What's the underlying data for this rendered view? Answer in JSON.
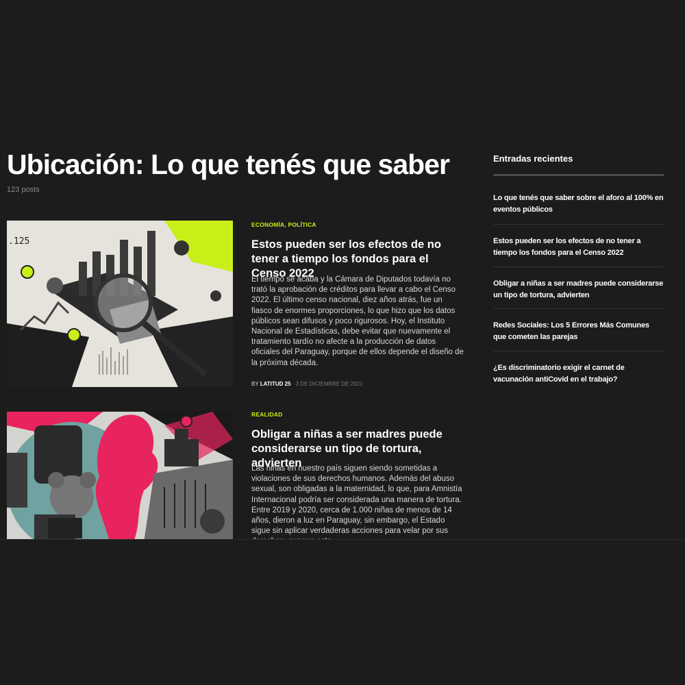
{
  "archive": {
    "title": "Ubicación: Lo que tenés que saber",
    "post_count": "123 posts"
  },
  "articles": [
    {
      "categories": [
        "ECONOMÍA",
        "POLÍTICA"
      ],
      "category_separator": ",",
      "title": "Estos pueden ser los efectos de no tener a tiempo los fondos para el Censo 2022",
      "excerpt": "El tiempo se acaba y la Cámara de Diputados todavía no trató la aprobación de créditos para llevar a cabo el Censo 2022. El último censo nacional, diez años atrás, fue un fiasco de enormes proporciones, lo que hizo que los datos públicos sean difusos y poco rigurosos. Hoy, el Instituto Nacional de Estadísticas, debe evitar que nuevamente el tratamiento tardío no afecte a la producción de datos oficiales del Paraguay, porque de ellos depende el diseño de la próxima década.",
      "by_label": "BY",
      "author": "LATITUD 25",
      "date": "3 DE DICIEMBRE DE 2021",
      "image_text": ".125",
      "image": "census-collage-magnifying-glass"
    },
    {
      "categories": [
        "REALIDAD"
      ],
      "title": "Obligar a niñas a ser madres puede considerarse un tipo de tortura, advierten",
      "excerpt": "Las niñas en nuestro país siguen siendo sometidas a violaciones de sus derechos humanos. Además del abuso sexual, son obligadas a la maternidad, lo que, para Amnistía Internacional podría ser considerada una manera de tortura. Entre 2019 y 2020, cerca de 1.000 niñas de menos de 14 años, dieron a luz en Paraguay, sin embargo, el Estado sigue sin aplicar verdaderas acciones para velar por sus derechos, aunque esta",
      "image": "girl-silhouette-collage-pink"
    }
  ],
  "sidebar": {
    "title": "Entradas recientes",
    "items": [
      {
        "label": "Lo que tenés que saber sobre el aforo al 100% en eventos públicos"
      },
      {
        "label": "Estos pueden ser los efectos de no tener a tiempo los fondos para el Censo 2022"
      },
      {
        "label": "Obligar a niñas a ser madres puede considerarse un tipo de tortura, advierten"
      },
      {
        "label": "Redes Sociales: Los 5 Errores Más Comunes que cometen las parejas"
      },
      {
        "label": "¿Es discriminatorio exigir el carnet de vacunación antiCovid en el trabajo?"
      }
    ]
  },
  "colors": {
    "background": "#1c1c1c",
    "accent": "#c8f018",
    "pink": "#e8245e",
    "teal": "#6fa2a0"
  }
}
